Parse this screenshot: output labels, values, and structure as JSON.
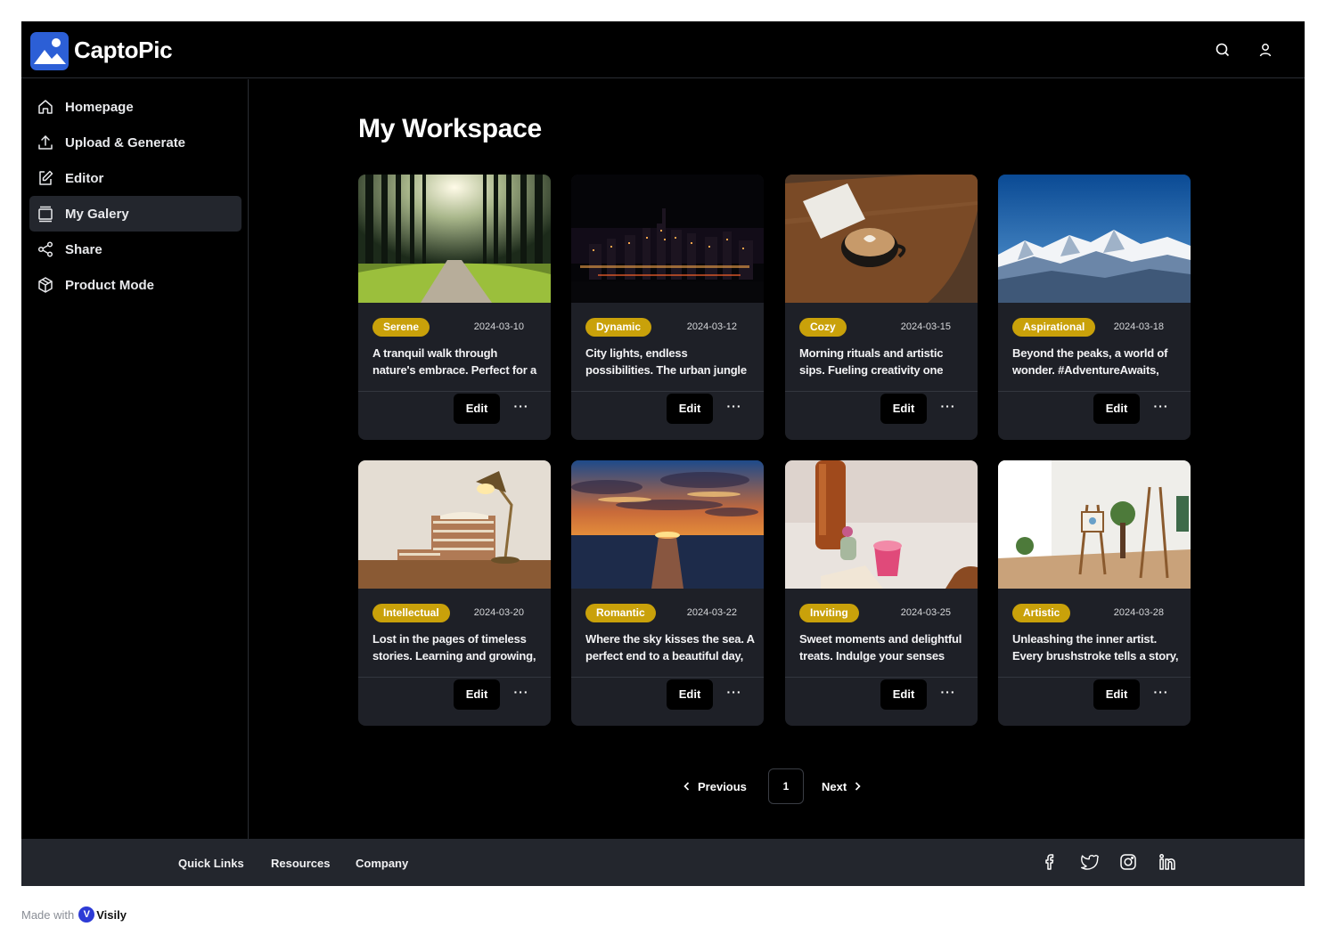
{
  "app": {
    "brand": "CaptoPic"
  },
  "header": {
    "search_icon": "search-icon",
    "user_icon": "user-icon"
  },
  "sidebar": {
    "items": [
      {
        "label": "Homepage",
        "icon": "home-icon",
        "active": false
      },
      {
        "label": "Upload & Generate",
        "icon": "upload-icon",
        "active": false
      },
      {
        "label": "Editor",
        "icon": "edit-icon",
        "active": false
      },
      {
        "label": "My Galery",
        "icon": "gallery-icon",
        "active": true
      },
      {
        "label": "Share",
        "icon": "share-icon",
        "active": false
      },
      {
        "label": "Product Mode",
        "icon": "box-icon",
        "active": false
      }
    ]
  },
  "main": {
    "title": "My Workspace",
    "cards": [
      {
        "tag": "Serene",
        "date": "2024-03-10",
        "desc": "A tranquil walk through nature's embrace. Perfect for a",
        "edit": "Edit",
        "more": "···"
      },
      {
        "tag": "Dynamic",
        "date": "2024-03-12",
        "desc": "City lights, endless possibilities. The urban jungle",
        "edit": "Edit",
        "more": "···"
      },
      {
        "tag": "Cozy",
        "date": "2024-03-15",
        "desc": "Morning rituals and artistic sips. Fueling creativity one",
        "edit": "Edit",
        "more": "···"
      },
      {
        "tag": "Aspirational",
        "date": "2024-03-18",
        "desc": "Beyond the peaks, a world of wonder. #AdventureAwaits,",
        "edit": "Edit",
        "more": "···"
      },
      {
        "tag": "Intellectual",
        "date": "2024-03-20",
        "desc": "Lost in the pages of timeless stories. Learning and growing,",
        "edit": "Edit",
        "more": "···"
      },
      {
        "tag": "Romantic",
        "date": "2024-03-22",
        "desc": "Where the sky kisses the sea. A perfect end to a beautiful day,",
        "edit": "Edit",
        "more": "···"
      },
      {
        "tag": "Inviting",
        "date": "2024-03-25",
        "desc": "Sweet moments and delightful treats. Indulge your senses with",
        "edit": "Edit",
        "more": "···"
      },
      {
        "tag": "Artistic",
        "date": "2024-03-28",
        "desc": "Unleashing the inner artist. Every brushstroke tells a story,",
        "edit": "Edit",
        "more": "···"
      }
    ]
  },
  "pagination": {
    "previous": "Previous",
    "page": "1",
    "next": "Next"
  },
  "footer": {
    "links": [
      "Quick Links",
      "Resources",
      "Company"
    ],
    "social": [
      "facebook-icon",
      "twitter-icon",
      "instagram-icon",
      "linkedin-icon"
    ]
  },
  "badge": {
    "made_with": "Made with",
    "visily": "Visily"
  },
  "colors": {
    "accent_tag": "#c9a10a",
    "card_bg": "#1e2027",
    "sidebar_active": "#23262d",
    "logo": "#2c5fd6"
  }
}
